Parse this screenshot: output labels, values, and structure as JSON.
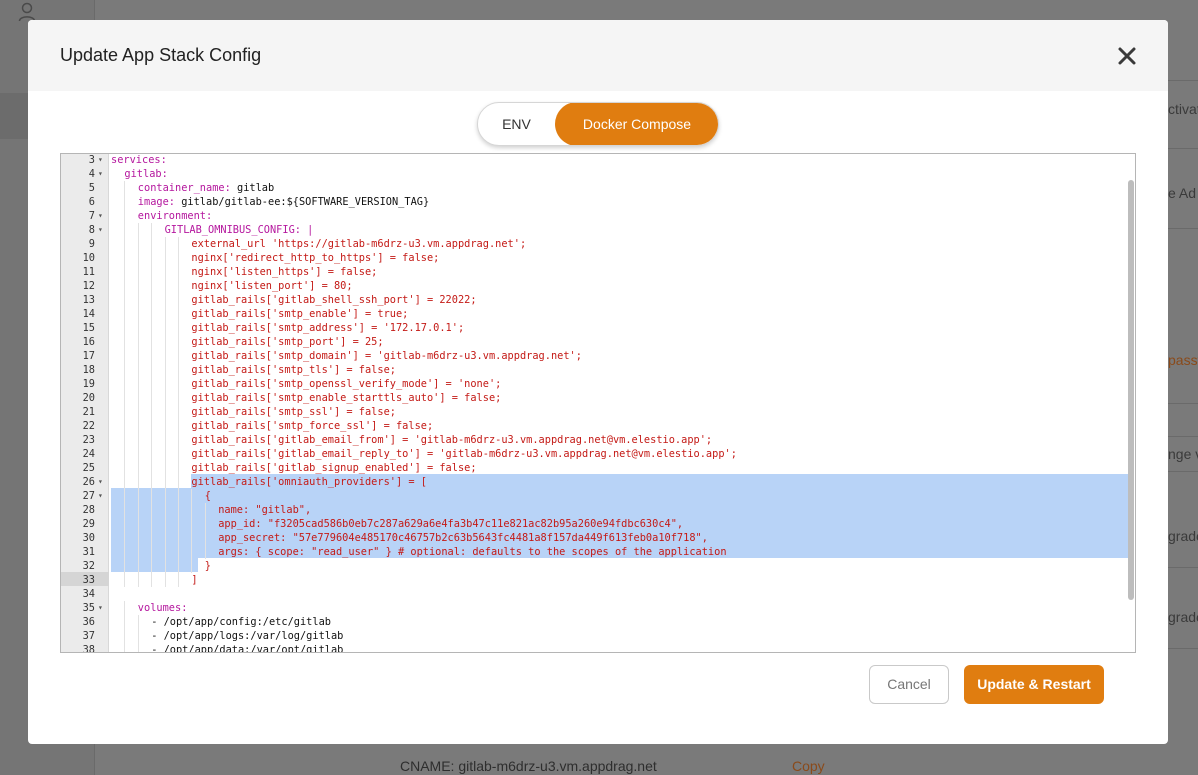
{
  "background": {
    "right_items": [
      "ctivat",
      "e Ad",
      "passw",
      "nge v",
      "grade",
      "grade"
    ],
    "bottom_cname": "CNAME: gitlab-m6drz-u3.vm.appdrag.net",
    "bottom_copy": "Copy"
  },
  "modal": {
    "title": "Update App Stack Config",
    "close_icon": "close-icon",
    "tabs": [
      {
        "label": "ENV",
        "active": false
      },
      {
        "label": "Docker Compose",
        "active": true
      }
    ],
    "cancel_label": "Cancel",
    "update_label": "Update & Restart",
    "accent_color": "#e07d10"
  },
  "editor": {
    "lines": [
      {
        "n": "3",
        "fold": true,
        "indent": 0,
        "key": "services:",
        "val": "",
        "str": ""
      },
      {
        "n": "4",
        "fold": true,
        "indent": 1,
        "key": "gitlab:",
        "val": "",
        "str": ""
      },
      {
        "n": "5",
        "fold": false,
        "indent": 2,
        "key": "container_name:",
        "val": " gitlab",
        "str": ""
      },
      {
        "n": "6",
        "fold": false,
        "indent": 2,
        "key": "image:",
        "val": " gitlab/gitlab-ee:${SOFTWARE_VERSION_TAG}",
        "str": ""
      },
      {
        "n": "7",
        "fold": true,
        "indent": 2,
        "key": "environment:",
        "val": "",
        "str": ""
      },
      {
        "n": "8",
        "fold": true,
        "indent": 4,
        "key": "GITLAB_OMNIBUS_CONFIG: |",
        "val": "",
        "str": ""
      },
      {
        "n": "9",
        "fold": false,
        "indent": 6,
        "key": "",
        "val": "",
        "str": "external_url 'https://gitlab-m6drz-u3.vm.appdrag.net';"
      },
      {
        "n": "10",
        "fold": false,
        "indent": 6,
        "key": "",
        "val": "",
        "str": "nginx['redirect_http_to_https'] = false;"
      },
      {
        "n": "11",
        "fold": false,
        "indent": 6,
        "key": "",
        "val": "",
        "str": "nginx['listen_https'] = false;"
      },
      {
        "n": "12",
        "fold": false,
        "indent": 6,
        "key": "",
        "val": "",
        "str": "nginx['listen_port'] = 80;"
      },
      {
        "n": "13",
        "fold": false,
        "indent": 6,
        "key": "",
        "val": "",
        "str": "gitlab_rails['gitlab_shell_ssh_port'] = 22022;"
      },
      {
        "n": "14",
        "fold": false,
        "indent": 6,
        "key": "",
        "val": "",
        "str": "gitlab_rails['smtp_enable'] = true;"
      },
      {
        "n": "15",
        "fold": false,
        "indent": 6,
        "key": "",
        "val": "",
        "str": "gitlab_rails['smtp_address'] = '172.17.0.1';"
      },
      {
        "n": "16",
        "fold": false,
        "indent": 6,
        "key": "",
        "val": "",
        "str": "gitlab_rails['smtp_port'] = 25;"
      },
      {
        "n": "17",
        "fold": false,
        "indent": 6,
        "key": "",
        "val": "",
        "str": "gitlab_rails['smtp_domain'] = 'gitlab-m6drz-u3.vm.appdrag.net';"
      },
      {
        "n": "18",
        "fold": false,
        "indent": 6,
        "key": "",
        "val": "",
        "str": "gitlab_rails['smtp_tls'] = false;"
      },
      {
        "n": "19",
        "fold": false,
        "indent": 6,
        "key": "",
        "val": "",
        "str": "gitlab_rails['smtp_openssl_verify_mode'] = 'none';"
      },
      {
        "n": "20",
        "fold": false,
        "indent": 6,
        "key": "",
        "val": "",
        "str": "gitlab_rails['smtp_enable_starttls_auto'] = false;"
      },
      {
        "n": "21",
        "fold": false,
        "indent": 6,
        "key": "",
        "val": "",
        "str": "gitlab_rails['smtp_ssl'] = false;"
      },
      {
        "n": "22",
        "fold": false,
        "indent": 6,
        "key": "",
        "val": "",
        "str": "gitlab_rails['smtp_force_ssl'] = false;"
      },
      {
        "n": "23",
        "fold": false,
        "indent": 6,
        "key": "",
        "val": "",
        "str": "gitlab_rails['gitlab_email_from'] = 'gitlab-m6drz-u3.vm.appdrag.net@vm.elestio.app';"
      },
      {
        "n": "24",
        "fold": false,
        "indent": 6,
        "key": "",
        "val": "",
        "str": "gitlab_rails['gitlab_email_reply_to'] = 'gitlab-m6drz-u3.vm.appdrag.net@vm.elestio.app';"
      },
      {
        "n": "25",
        "fold": false,
        "indent": 6,
        "key": "",
        "val": "",
        "str": "gitlab_rails['gitlab_signup_enabled'] = false;"
      },
      {
        "n": "26",
        "fold": true,
        "indent": 6,
        "key": "",
        "val": "",
        "str": "gitlab_rails['omniauth_providers'] = ["
      },
      {
        "n": "27",
        "fold": true,
        "indent": 7,
        "key": "",
        "val": "",
        "str": "{"
      },
      {
        "n": "28",
        "fold": false,
        "indent": 8,
        "key": "",
        "val": "",
        "str": "name: \"gitlab\","
      },
      {
        "n": "29",
        "fold": false,
        "indent": 8,
        "key": "",
        "val": "",
        "str": "app_id: \"f3205cad586b0eb7c287a629a6e4fa3b47c11e821ac82b95a260e94fdbc630c4\","
      },
      {
        "n": "30",
        "fold": false,
        "indent": 8,
        "key": "",
        "val": "",
        "str": "app_secret: \"57e779604e485170c46757b2c63b5643fc4481a8f157da449f613feb0a10f718\","
      },
      {
        "n": "31",
        "fold": false,
        "indent": 8,
        "key": "",
        "val": "",
        "str": "args: { scope: \"read_user\" } # optional: defaults to the scopes of the application"
      },
      {
        "n": "32",
        "fold": false,
        "indent": 7,
        "key": "",
        "val": "",
        "str": "}"
      },
      {
        "n": "33",
        "fold": false,
        "indent": 6,
        "key": "",
        "val": "",
        "str": "]"
      },
      {
        "n": "34",
        "fold": false,
        "indent": 0,
        "key": "",
        "val": "",
        "str": ""
      },
      {
        "n": "35",
        "fold": true,
        "indent": 2,
        "key": "volumes:",
        "val": "",
        "str": ""
      },
      {
        "n": "36",
        "fold": false,
        "indent": 3,
        "key": "",
        "val": "- /opt/app/config:/etc/gitlab",
        "str": ""
      },
      {
        "n": "37",
        "fold": false,
        "indent": 3,
        "key": "",
        "val": "- /opt/app/logs:/var/log/gitlab",
        "str": ""
      },
      {
        "n": "38",
        "fold": false,
        "indent": 3,
        "key": "",
        "val": "- /opt/app/data:/var/opt/gitlab",
        "str": ""
      }
    ]
  }
}
